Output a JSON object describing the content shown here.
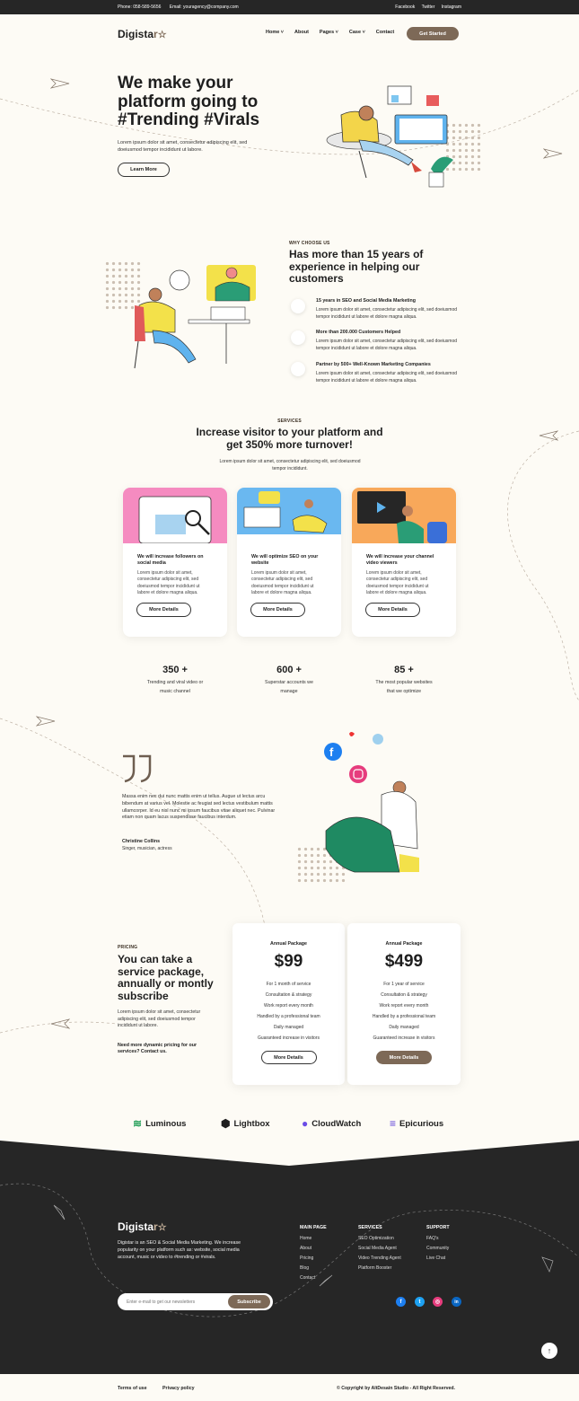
{
  "topbar": {
    "phone": "Phone: 058-589-5656",
    "email": "Email: youragency@company.com",
    "facebook": "Facebook",
    "twitter": "Twitter",
    "instagram": "Instagram"
  },
  "brand": {
    "name_part1": "Digista",
    "name_part2": "r"
  },
  "nav": {
    "home": "Home",
    "about": "About",
    "pages": "Pages",
    "case": "Case",
    "contact": "Contact",
    "cta": "Get Started"
  },
  "hero": {
    "title_line1": "We make your",
    "title_line2": "platform going to",
    "title_line3": "#Trending #Virals",
    "text": "Lorem ipsum dolor sit amet, consectetur adipiscing elit, sed doeiusmod tempor incididunt ut labore.",
    "button": "Learn More"
  },
  "why": {
    "label": "WHY CHOOSE US",
    "title": "Has more than 15 years of experience in helping our customers",
    "features": [
      {
        "title": "15 years in SEO and Social Media Marketing",
        "text": "Lorem ipsum dolor sit amet, consectetur adipiscing elit, sed doeiusmod tempor incididunt ut labore et dolore magna aliqua."
      },
      {
        "title": "More than 200.000 Customers Helped",
        "text": "Lorem ipsum dolor sit amet, consectetur adipiscing elit, sed doeiusmod tempor incididunt ut labore et dolore magna aliqua."
      },
      {
        "title": "Partner by 500+ Well-Known Marketing Companies",
        "text": "Lorem ipsum dolor sit amet, consectetur adipiscing elit, sed doeiusmod tempor incididunt ut labore et dolore magna aliqua."
      }
    ]
  },
  "services": {
    "label": "SERVICES",
    "title_line1": "Increase visitor to your platform and",
    "title_line2": "get 350% more turnover!",
    "text": "Lorem ipsum dolor sit amet, consectetur adipiscing elit, sed doeiusmod tempor incididunt.",
    "cards": [
      {
        "title": "We will increase followers on social media",
        "text": "Lorem ipsum dolor sit amet, consectetur adipiscing elit, sed doeiusmod tempor incididunt ut labore et dolore magna aliqua.",
        "button": "More Details"
      },
      {
        "title": "We will optimize SEO on your website",
        "text": "Lorem ipsum dolor sit amet, consectetur adipiscing elit, sed doeiusmod tempor incididunt ut labore et dolore magna aliqua.",
        "button": "More Details"
      },
      {
        "title": "We will increase your channel video viewers",
        "text": "Lorem ipsum dolor sit amet, consectetur adipiscing elit, sed doeiusmod tempor incididunt ut labore et dolore magna aliqua.",
        "button": "More Details"
      }
    ]
  },
  "stats": [
    {
      "number": "350 +",
      "line1": "Trending and viral video or",
      "line2": "music channel"
    },
    {
      "number": "600 +",
      "line1": "Superstar accounts we",
      "line2": "manage"
    },
    {
      "number": "85 +",
      "line1": "The most popular websites",
      "line2": "that we optimize"
    }
  ],
  "testimonial": {
    "quote": "Massa enim nec dui nunc mattis enim ut tellus. Augue ut lectus arcu bibendum at varius vel. Molestie ac feugiat sed lectus vestibulum mattis ullamcorper. Id eu nisl nunc mi ipsum faucibus vitae aliquet nec. Pulvinar etiam non quam lacus suspendisse faucibus interdum.",
    "name": "Christine Collins",
    "role": "Singer, musician, actress"
  },
  "pricing": {
    "label": "PRICING",
    "title": "You can take a service package, annually or montly subscribe",
    "text": "Lorem ipsum dolor sit amet, consectetur adipiscing elit, sed doeiusmod tempor incididunt ut labore.",
    "note": "Need more dynamic pricing for our services? Contact us.",
    "plans": [
      {
        "label": "Annual Package",
        "price": "$99",
        "items": [
          "For 1 month of service",
          "Consultation & strategy",
          "Work report every month",
          "Handled by a professional team",
          "Daily managed",
          "Guaranteed increase in visitors"
        ],
        "button": "More Details"
      },
      {
        "label": "Annual Package",
        "price": "$499",
        "items": [
          "For 1 year of service",
          "Consultation & strategy",
          "Work report every month",
          "Handled by a professional team",
          "Daily managed",
          "Guaranteed increase in visitors"
        ],
        "button": "More Details"
      }
    ]
  },
  "brands": [
    "Luminous",
    "Lightbox",
    "CloudWatch",
    "Epicurious"
  ],
  "footer": {
    "desc": "Digistar is an SEO & Social Media Marketing. We increase popularity on your platform such as: website, social media account, music or video to #trending or #virals.",
    "newsletter_placeholder": "Enter e-mail to get our newsletters",
    "subscribe": "Subscribe",
    "col1": {
      "title": "MAIN PAGE",
      "links": [
        "Home",
        "About",
        "Pricing",
        "Blog",
        "Contact"
      ]
    },
    "col2": {
      "title": "SERVICES",
      "links": [
        "SEO Optimization",
        "Social Media Agent",
        "Video Trending Agent",
        "Platform Booster"
      ]
    },
    "col3": {
      "title": "SUPPORT",
      "links": [
        "FAQ's",
        "Community",
        "Live Chat"
      ]
    },
    "terms": "Terms of use",
    "privacy": "Privacy policy",
    "copyright": "© Copyright by AltDesain Studio - All Right Reserved."
  },
  "colors": {
    "accent": "#7d6957",
    "dark": "#262626",
    "bg": "#fdfbf5"
  }
}
